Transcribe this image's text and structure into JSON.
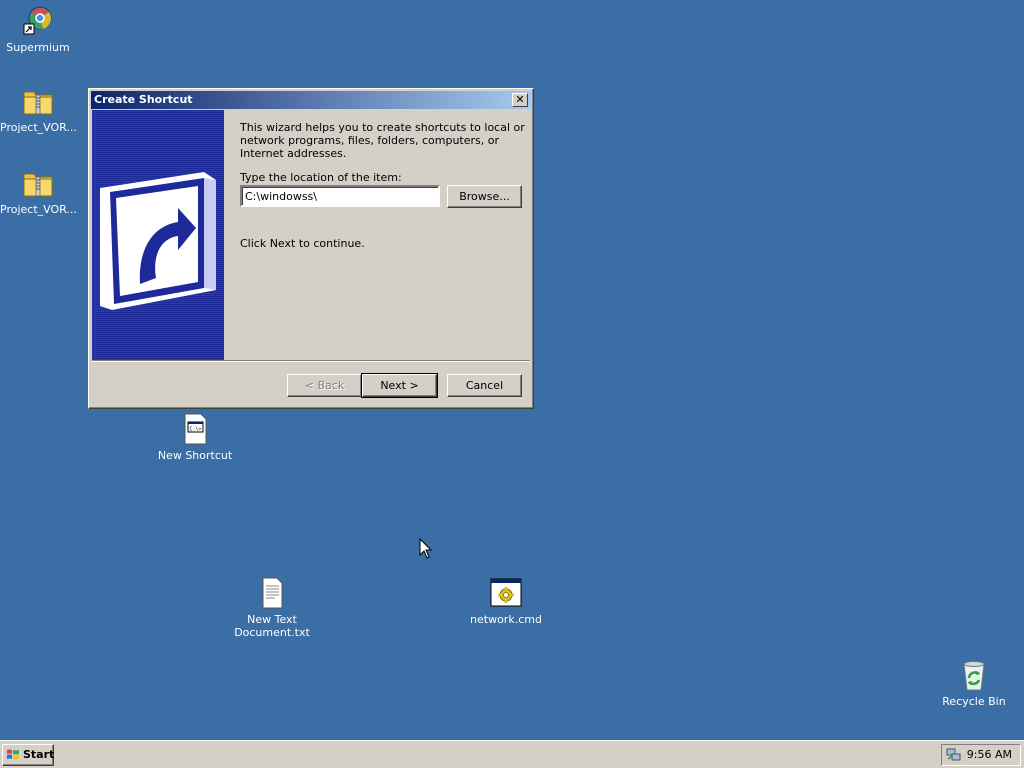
{
  "desktop": {
    "icons": [
      {
        "label": "Supermium",
        "icon": "browser-shortcut-icon"
      },
      {
        "label": "Project_VOR...",
        "icon": "zip-folder-icon"
      },
      {
        "label": "Project_VOR...",
        "icon": "zip-folder-icon"
      },
      {
        "label": "New Shortcut",
        "icon": "shortcut-file-icon"
      },
      {
        "label": "New Text\nDocument.txt",
        "icon": "text-file-icon"
      },
      {
        "label": "network.cmd",
        "icon": "cmd-file-icon"
      },
      {
        "label": "Recycle Bin",
        "icon": "recycle-bin-icon"
      }
    ]
  },
  "dialog": {
    "title": "Create Shortcut",
    "close_label": "✕",
    "intro": "This wizard helps you to create shortcuts to local or network programs, files, folders, computers, or Internet addresses.",
    "location_label": "Type the location of the item:",
    "location_value": "C:\\windowss\\",
    "browse_label": "Browse...",
    "continue_text": "Click Next to continue.",
    "back_label": "< Back",
    "next_label": "Next >",
    "cancel_label": "Cancel"
  },
  "taskbar": {
    "start_label": "Start",
    "clock": "9:56 AM"
  },
  "colors": {
    "desktop": "#3a6ea5",
    "titlebar_start": "#0a246a",
    "titlebar_end": "#a6caf0",
    "face": "#d4d0c8"
  }
}
